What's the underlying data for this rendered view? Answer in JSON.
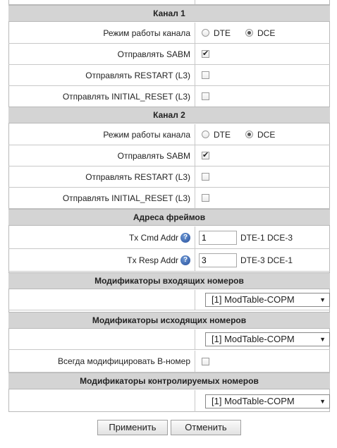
{
  "channel1": {
    "header": "Канал 1",
    "mode_label": "Режим работы канала",
    "mode_options": [
      "DTE",
      "DCE"
    ],
    "mode_selected": "DCE",
    "sabm_label": "Отправлять SABM",
    "sabm_checked": true,
    "restart_label": "Отправлять RESTART (L3)",
    "restart_checked": false,
    "initreset_label": "Отправлять INITIAL_RESET (L3)",
    "initreset_checked": false
  },
  "channel2": {
    "header": "Канал 2",
    "mode_label": "Режим работы канала",
    "mode_options": [
      "DTE",
      "DCE"
    ],
    "mode_selected": "DCE",
    "sabm_label": "Отправлять SABM",
    "sabm_checked": true,
    "restart_label": "Отправлять RESTART (L3)",
    "restart_checked": false,
    "initreset_label": "Отправлять INITIAL_RESET (L3)",
    "initreset_checked": false
  },
  "frames": {
    "header": "Адреса фреймов",
    "tx_cmd_label": "Tx Cmd Addr",
    "tx_cmd_value": "1",
    "tx_cmd_hint": "DTE-1 DCE-3",
    "tx_resp_label": "Tx Resp Addr",
    "tx_resp_value": "3",
    "tx_resp_hint": "DTE-3 DCE-1",
    "help_glyph": "?"
  },
  "incoming": {
    "header": "Модификаторы входящих номеров",
    "selected": "[1] ModTable-COPM"
  },
  "outgoing": {
    "header": "Модификаторы исходящих номеров",
    "selected": "[1] ModTable-COPM",
    "always_label": "Всегда модифицировать В-номер",
    "always_checked": false
  },
  "controlled": {
    "header": "Модификаторы контролируемых номеров",
    "selected": "[1] ModTable-COPM"
  },
  "buttons": {
    "apply": "Применить",
    "cancel": "Отменить"
  },
  "icons": {
    "dropdown": "triangle-down",
    "help": "help-circle"
  }
}
